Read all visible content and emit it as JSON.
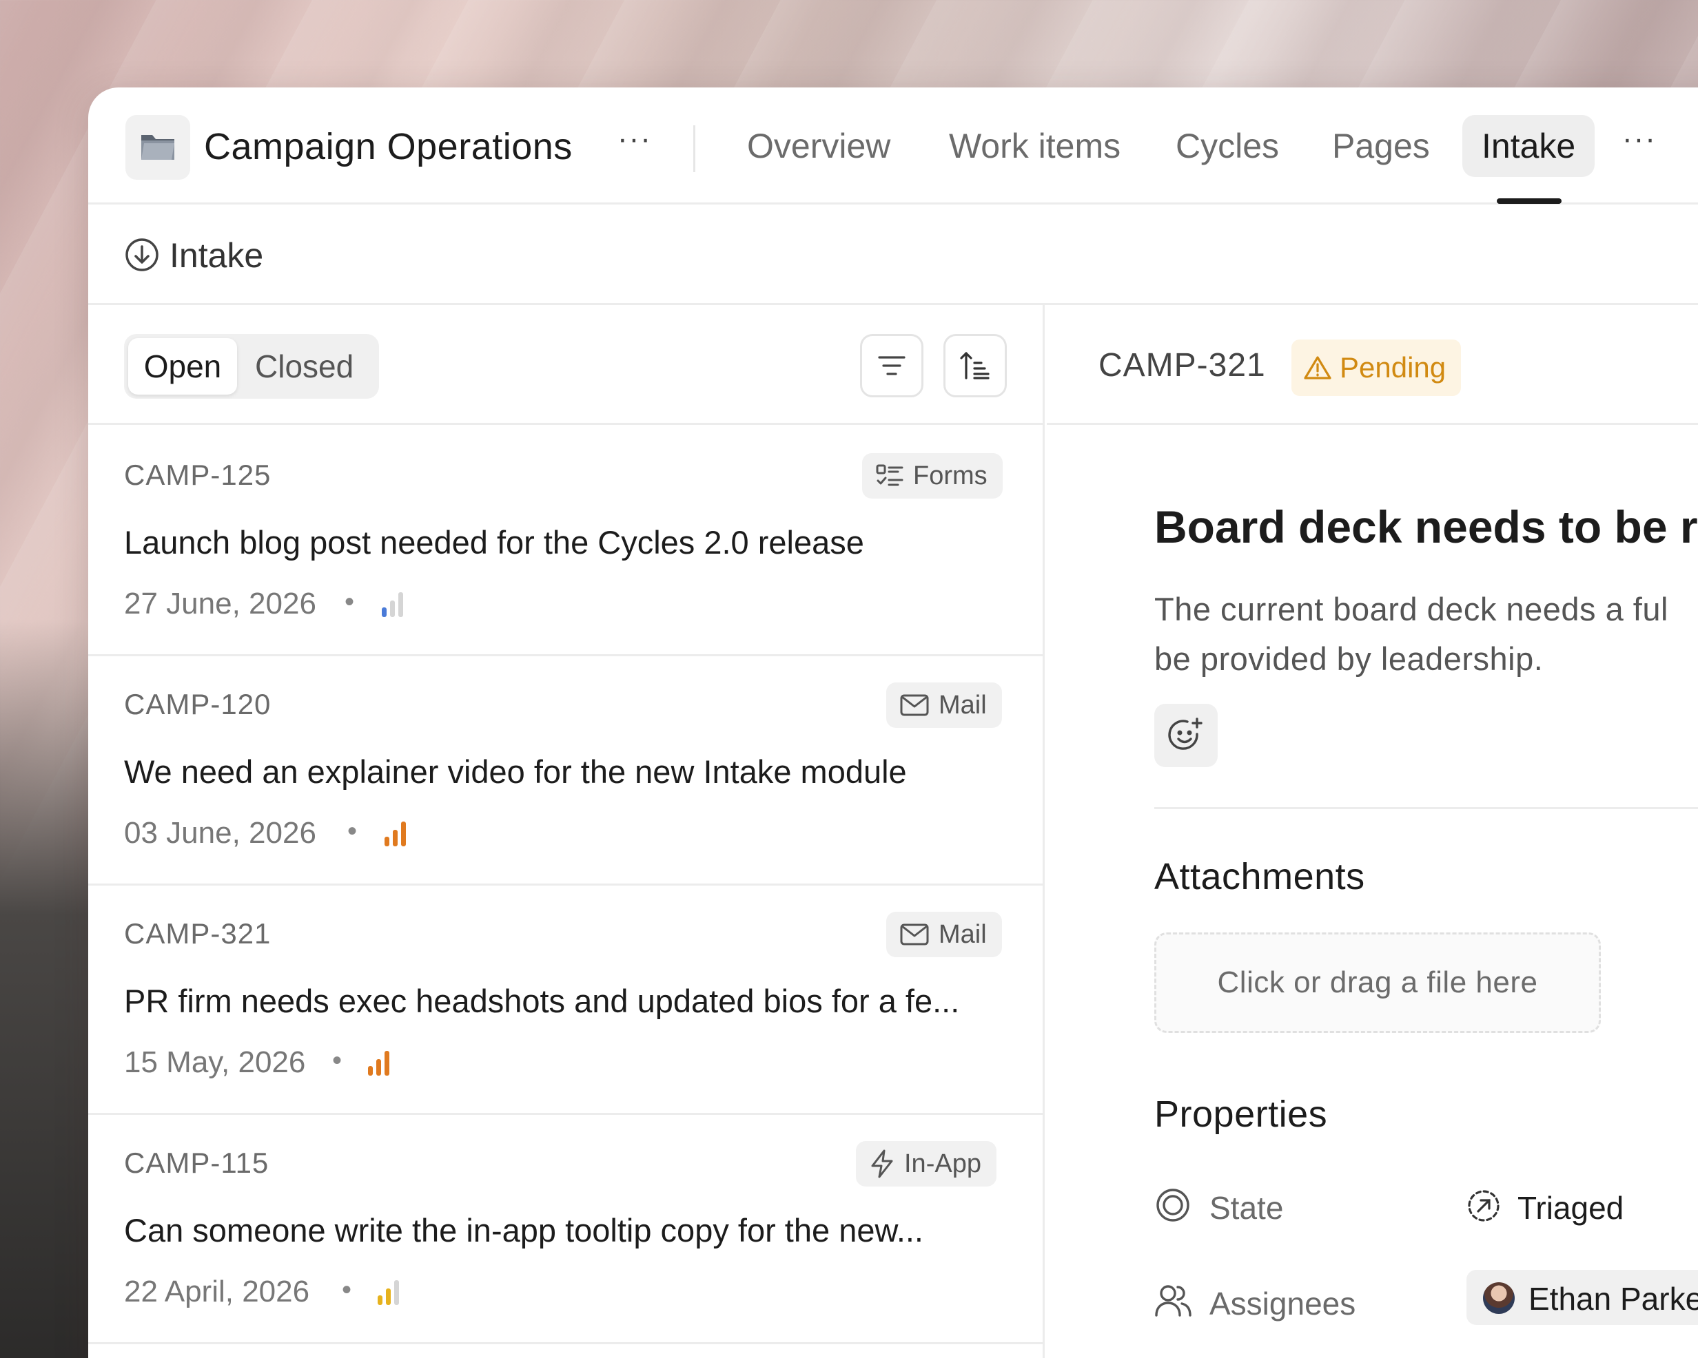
{
  "header": {
    "project_title": "Campaign Operations",
    "more_label": "···",
    "tabs": [
      {
        "label": "Overview"
      },
      {
        "label": "Work items"
      },
      {
        "label": "Cycles"
      },
      {
        "label": "Pages"
      },
      {
        "label": "Intake",
        "active": true
      }
    ],
    "tabs_more_label": "···"
  },
  "breadcrumb": {
    "label": "Intake"
  },
  "filters": {
    "open_label": "Open",
    "closed_label": "Closed",
    "selected": "Open"
  },
  "items": [
    {
      "id": "CAMP-125",
      "source": "Forms",
      "title": "Launch blog post needed for the Cycles 2.0 release",
      "date": "27 June, 2026",
      "dot": "•",
      "priority": "low"
    },
    {
      "id": "CAMP-120",
      "source": "Mail",
      "title": "We need an explainer video for the new Intake module",
      "date": "03 June, 2026",
      "dot": "•",
      "priority": "high"
    },
    {
      "id": "CAMP-321",
      "source": "Mail",
      "title": "PR firm needs exec headshots and updated bios for a fe...",
      "date": "15 May, 2026",
      "dot": "•",
      "priority": "high"
    },
    {
      "id": "CAMP-115",
      "source": "In-App",
      "title": "Can someone write the in-app tooltip copy for the new...",
      "date": "22 April, 2026",
      "dot": "•",
      "priority": "medium"
    }
  ],
  "detail": {
    "id": "CAMP-321",
    "status": "Pending",
    "title": "Board deck needs to be r",
    "description_line1": "The current board deck needs a ful",
    "description_line2": "be provided by leadership.",
    "attachments_title": "Attachments",
    "dropzone_label": "Click or drag a file here",
    "properties_title": "Properties",
    "properties": {
      "state_label": "State",
      "state_value": "Triaged",
      "assignees_label": "Assignees",
      "assignee_value": "Ethan Parke"
    }
  },
  "colors": {
    "priority_low": "#4a7bd8",
    "priority_high": "#e07a1f",
    "priority_medium": "#e6b21e",
    "pending": "#d18a12"
  }
}
